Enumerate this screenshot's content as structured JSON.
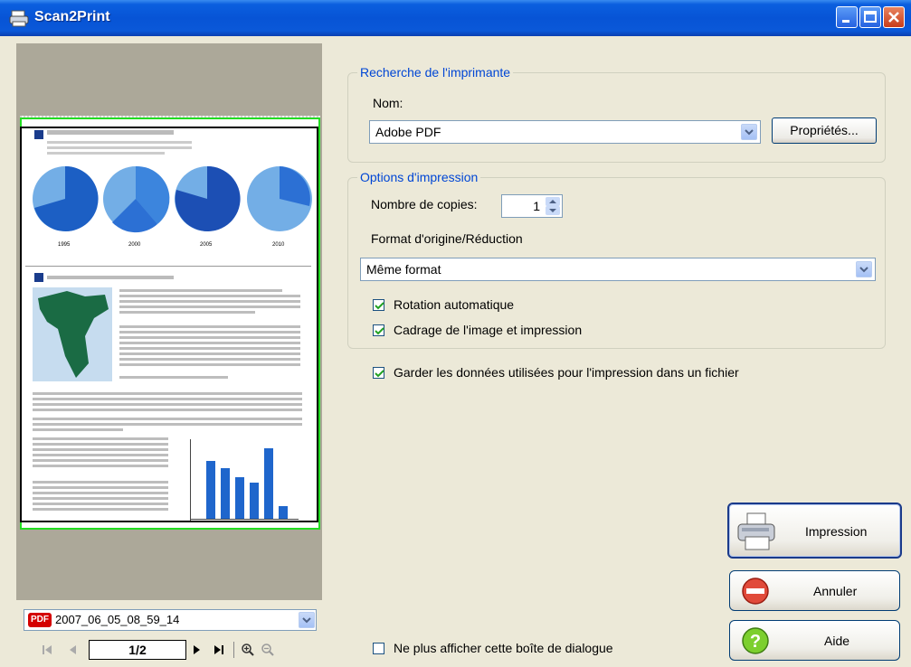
{
  "window": {
    "title": "Scan2Print"
  },
  "printer_group": {
    "legend": "Recherche de l'imprimante",
    "name_label": "Nom:",
    "printer_value": "Adobe PDF",
    "properties_button": "Propriétés..."
  },
  "print_options": {
    "legend": "Options d'impression",
    "copies_label": "Nombre de copies:",
    "copies_value": "1",
    "format_label": "Format d'origine/Réduction",
    "format_value": "Même format",
    "auto_rotate_label": "Rotation automatique",
    "auto_rotate_checked": true,
    "crop_label": "Cadrage de l'image et impression",
    "crop_checked": true
  },
  "keep_data": {
    "label": "Garder les données utilisées pour l'impression dans un fichier",
    "checked": true
  },
  "dont_show": {
    "label": "Ne plus afficher cette boîte de dialogue",
    "checked": false
  },
  "buttons": {
    "print": "Impression",
    "cancel": "Annuler",
    "help": "Aide"
  },
  "preview": {
    "file_badge": "PDF",
    "file_name": "2007_06_05_08_59_14",
    "page_indicator": "1/2",
    "year_labels": [
      "1995",
      "2000",
      "2005",
      "2010"
    ]
  },
  "colors": {
    "accent": "#0046d5",
    "titlebar": "#0754d6",
    "frame": "#22dd22"
  }
}
